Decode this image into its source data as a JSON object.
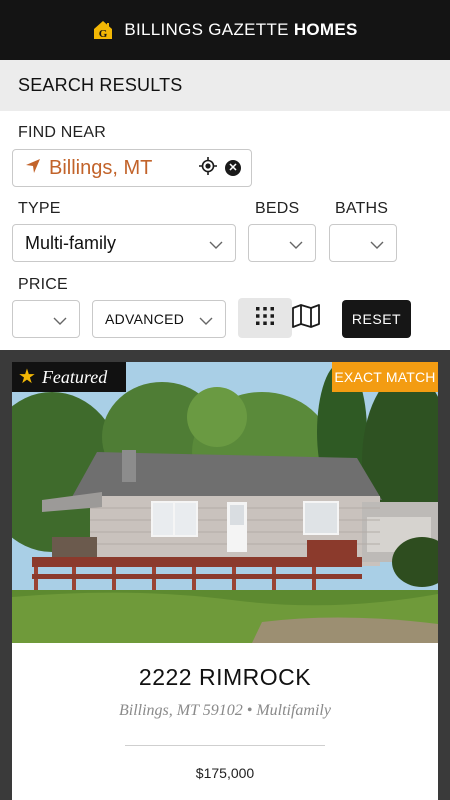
{
  "header": {
    "brand_light": "BILLINGS GAZETTE",
    "brand_bold": "HOMES",
    "logo_icon": "gazette-house-logo"
  },
  "results": {
    "title": "SEARCH RESULTS"
  },
  "filters": {
    "find_near_label": "FIND NEAR",
    "find_near_value": "Billings, MT",
    "type_label": "TYPE",
    "type_value": "Multi-family",
    "beds_label": "BEDS",
    "beds_value": "",
    "baths_label": "BATHS",
    "baths_value": "",
    "price_label": "PRICE",
    "price_value": "",
    "advanced_label": "ADVANCED",
    "reset_label": "RESET",
    "accent_color": "#c2632a"
  },
  "listing": {
    "featured_label": "Featured",
    "badge_label": "EXACT MATCH",
    "badge_color": "#f39c12",
    "address": "2222 RIMROCK",
    "location_line": "Billings, MT 59102 • Multifamily",
    "price": "$175,000"
  }
}
